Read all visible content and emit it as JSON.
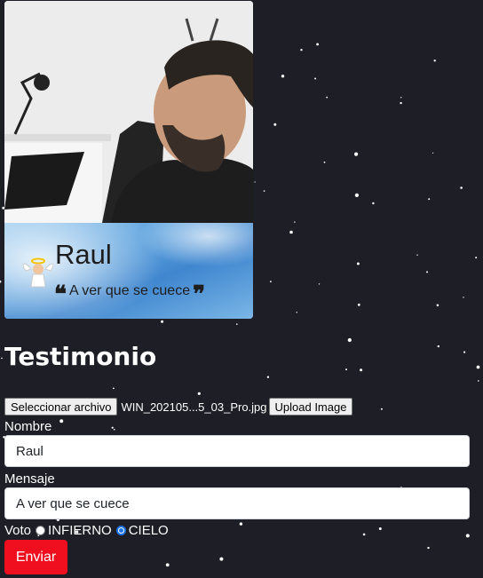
{
  "card": {
    "name": "Raul",
    "quote": "A ver que se cuece",
    "quote_open": "❝",
    "quote_close": "❞"
  },
  "form": {
    "title": "Testimonio",
    "file_button": "Seleccionar archivo",
    "file_name": "WIN_202105...5_03_Pro.jpg",
    "upload_button": "Upload Image",
    "nombre_label": "Nombre",
    "nombre_value": "Raul",
    "mensaje_label": "Mensaje",
    "mensaje_value": "A ver que se cuece",
    "voto_label": "Voto",
    "options": [
      {
        "label": "INFIERNO",
        "selected": false
      },
      {
        "label": "CIELO",
        "selected": true
      }
    ],
    "submit": "Enviar"
  },
  "colors": {
    "background": "#1d1e26",
    "submit": "#f00f1f",
    "radio_selected": "#1a73e8"
  }
}
